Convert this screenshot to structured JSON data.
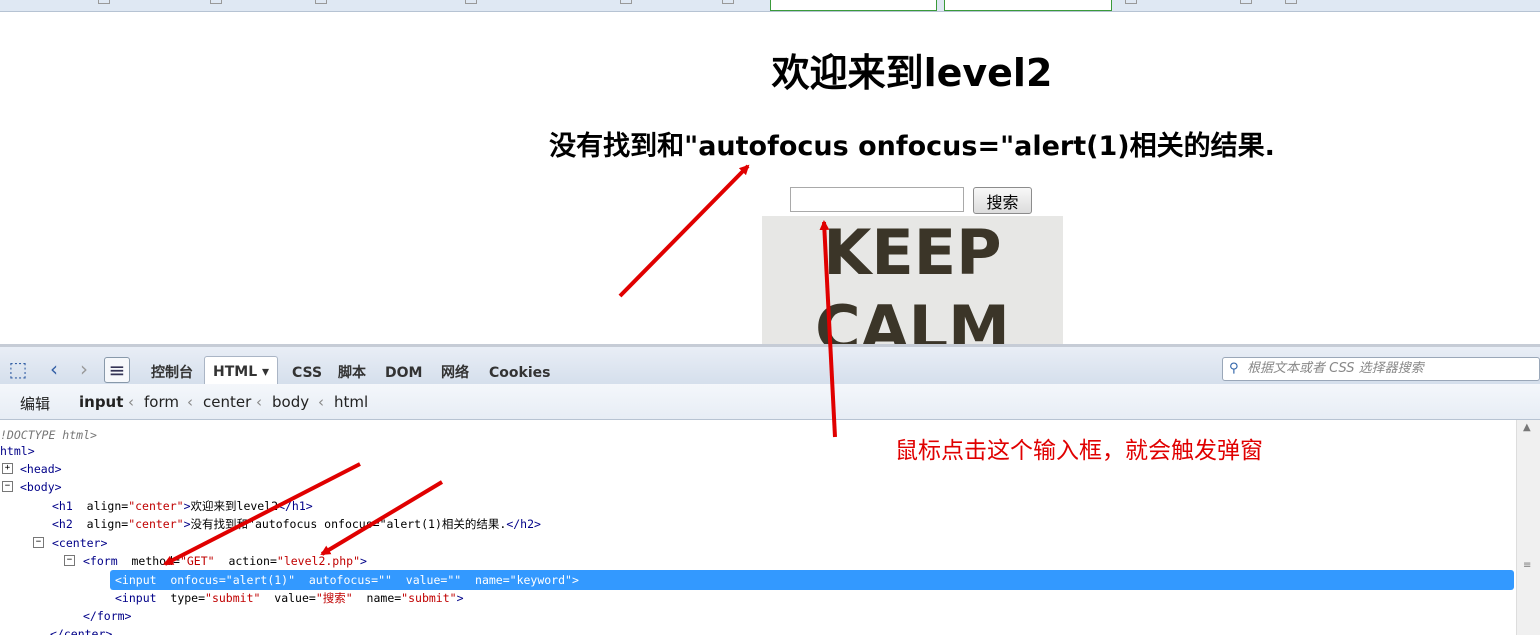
{
  "page": {
    "heading": "欢迎来到level2",
    "result_message": "没有找到和\"autofocus onfocus=\"alert(1)相关的结果.",
    "search_input_value": "",
    "search_button_label": "搜索",
    "poster_line1": "KEEP",
    "poster_line2": "CALM"
  },
  "devtools": {
    "tabs": [
      "控制台",
      "HTML",
      "CSS",
      "脚本",
      "DOM",
      "网络",
      "Cookies"
    ],
    "active_tab": "HTML",
    "search_placeholder": "根据文本或者 CSS 选择器搜索",
    "edit_button": "编辑",
    "breadcrumbs": [
      "input",
      "form",
      "center",
      "body",
      "html"
    ],
    "tree": {
      "doctype": "!DOCTYPE html>",
      "html_open": "html>",
      "head": "<head>",
      "body": "<body>",
      "h1_tag": "<h1",
      "h1_attr": "align=",
      "h1_val": "\"center\"",
      "h1_text": "欢迎来到level2",
      "h1_close": "</h1>",
      "h2_tag": "<h2",
      "h2_attr": "align=",
      "h2_val": "\"center\"",
      "h2_text": "没有找到和\"autofocus onfocus=\"alert(1)相关的结果.",
      "h2_close": "</h2>",
      "center": "<center>",
      "form_tag": "<form",
      "form_method_attr": "method=",
      "form_method_val": "\"GET\"",
      "form_action_attr": "action=",
      "form_action_val": "\"level2.php\"",
      "form_end": ">",
      "input_selected": "<input  onfocus=\"alert(1)\"  autofocus=\"\"  value=\"\"  name=\"keyword\">",
      "input2_tag": "<input",
      "input2_type_attr": "type=",
      "input2_type_val": "\"submit\"",
      "input2_value_attr": "value=",
      "input2_value_val": "\"搜索\"",
      "input2_name_attr": "name=",
      "input2_name_val": "\"submit\"",
      "input2_end": ">",
      "form_close": "</form>",
      "center_close": "</center>"
    }
  },
  "annotation": "鼠标点击这个输入框，就会触发弹窗",
  "colors": {
    "arrow": "#e00000",
    "selection": "#3399ff"
  }
}
